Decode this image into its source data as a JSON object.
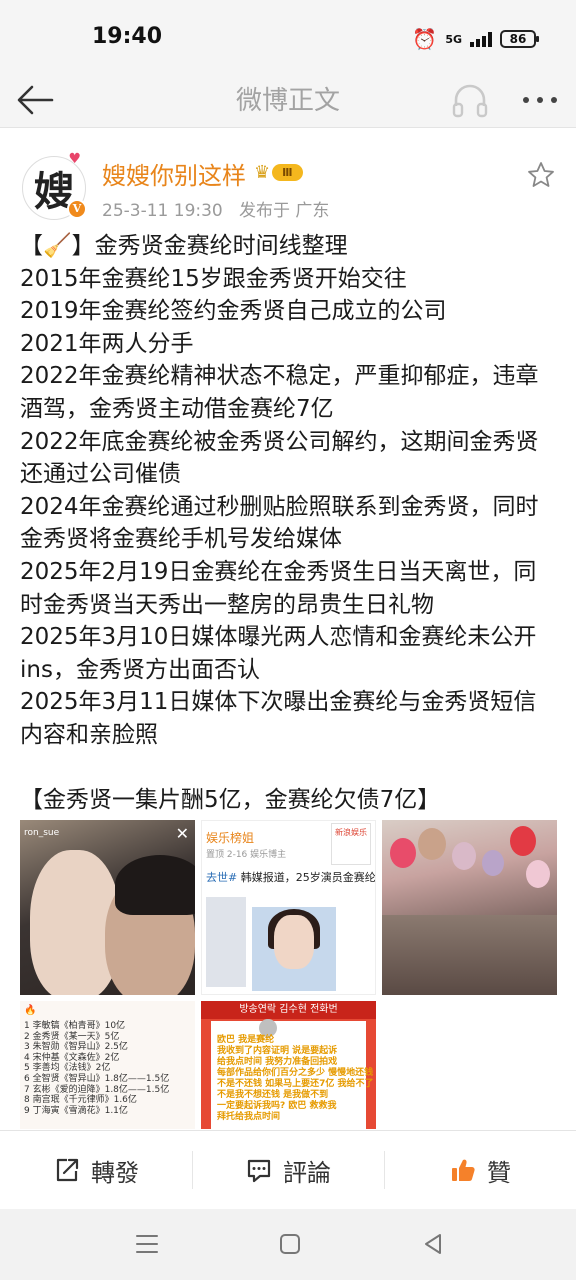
{
  "status_bar": {
    "time": "19:40",
    "network": "5G",
    "battery": "86"
  },
  "nav": {
    "title": "微博正文"
  },
  "post": {
    "avatar_char": "嫂",
    "user_name": "嫂嫂你别这样",
    "level_badge": "Ⅲ",
    "timestamp": "25-3-11 19:30",
    "location": "发布于 广东",
    "lines": [
      "【🧹】金秀贤金赛纶时间线整理",
      "2015年金赛纶15岁跟金秀贤开始交往",
      "2019年金赛纶签约金秀贤自己成立的公司",
      "2021年两人分手",
      "2022年金赛纶精神状态不稳定，严重抑郁症，违章",
      "酒驾，金秀贤主动借金赛纶7亿",
      "2022年底金赛纶被金秀贤公司解约，这期间金秀贤",
      "还通过公司催债",
      "2024年金赛纶通过秒删贴脸照联系到金秀贤，同时",
      "金秀贤将金赛纶手机号发给媒体",
      "2025年2月19日金赛纶在金秀贤生日当天离世，同",
      "时金秀贤当天秀出一整房的昂贵生日礼物",
      "2025年3月10日媒体曝光两人恋情和金赛纶未公开",
      "ins，金秀贤方出面否认",
      "2025年3月11日媒体下次曝出金赛纶与金秀贤短信",
      "内容和亲脸照"
    ],
    "footer_line": "【金秀贤一集片酬5亿，金赛纶欠债7亿】"
  },
  "images": {
    "img1": {
      "user": "ron_sue",
      "close": "✕"
    },
    "img2": {
      "header": "娱乐榜姐",
      "sub": "置顶  2-16  娱乐博主",
      "headline_tag": "去世#",
      "headline": " 韩媒报道，25岁演员金赛纶",
      "corner": "新浪娱乐"
    },
    "img4": {
      "title": "🔥",
      "ranks": [
        "1  李敏镐《柏青哥》10亿",
        "2  金秀贤《某一天》5亿",
        "3  朱智勋《智异山》2.5亿",
        "4  宋仲基《文森佐》2亿",
        "5  李善均《法钱》2亿",
        "6  全智贤《智异山》1.8亿——1.5亿",
        "7  玄彬《爱的迫降》1.8亿——1.5亿",
        "8  南宫珉《千元律师》1.6亿",
        "9  丁海寅《雪滴花》1.1亿"
      ]
    },
    "img5": {
      "banner": "방송연락  김수현  전화번",
      "lines": [
        "欧巴  我是赛纶",
        "我收到了内容证明 说是要起诉",
        "给我点时间 我努力准备回拍戏",
        "每部作品给你们百分之多少 慢慢地还钱",
        "不是不还钱 如果马上要还7亿 我给不了",
        "不是我不想还钱 是我做不到",
        "一定要起诉我吗? 欧巴 救救我",
        "拜托给我点时间"
      ]
    }
  },
  "actions": {
    "repost": "轉發",
    "comment": "評論",
    "like": "贊"
  },
  "colors": {
    "username": "#e8851b",
    "like_icon": "#f5812a",
    "badge": "#f4b71e"
  }
}
